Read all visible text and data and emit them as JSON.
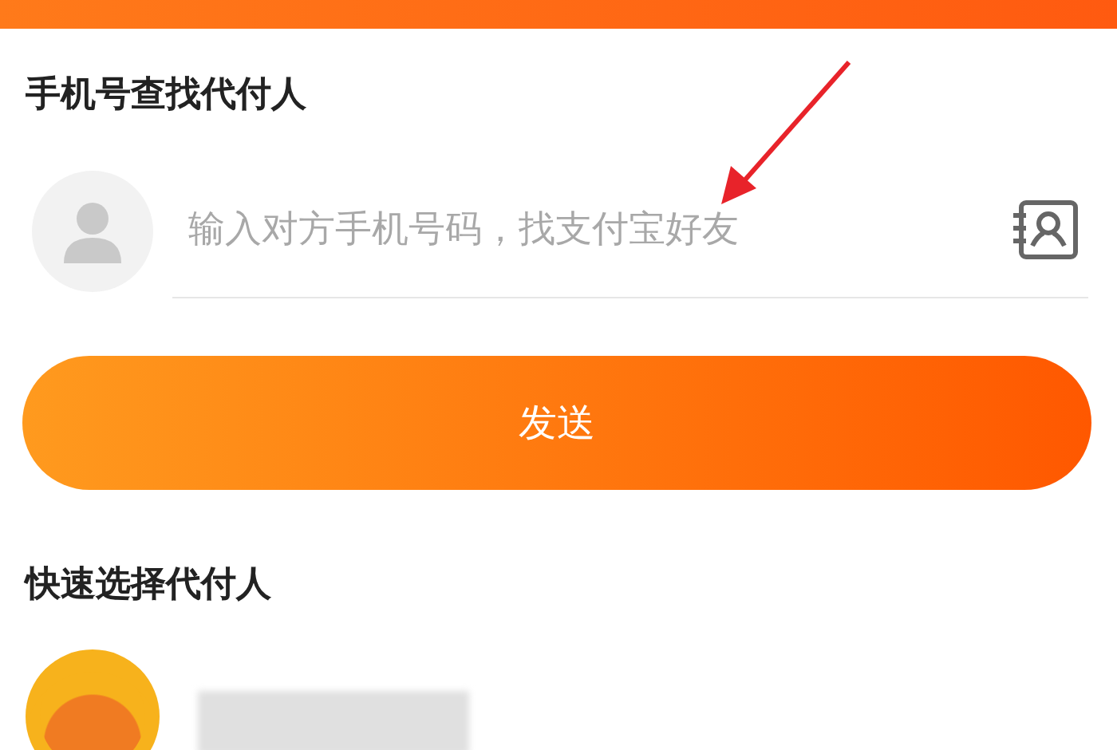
{
  "search_section": {
    "title": "手机号查找代付人",
    "placeholder": "输入对方手机号码，找支付宝好友"
  },
  "send_button": {
    "label": "发送"
  },
  "quick_section": {
    "title": "快速选择代付人"
  }
}
